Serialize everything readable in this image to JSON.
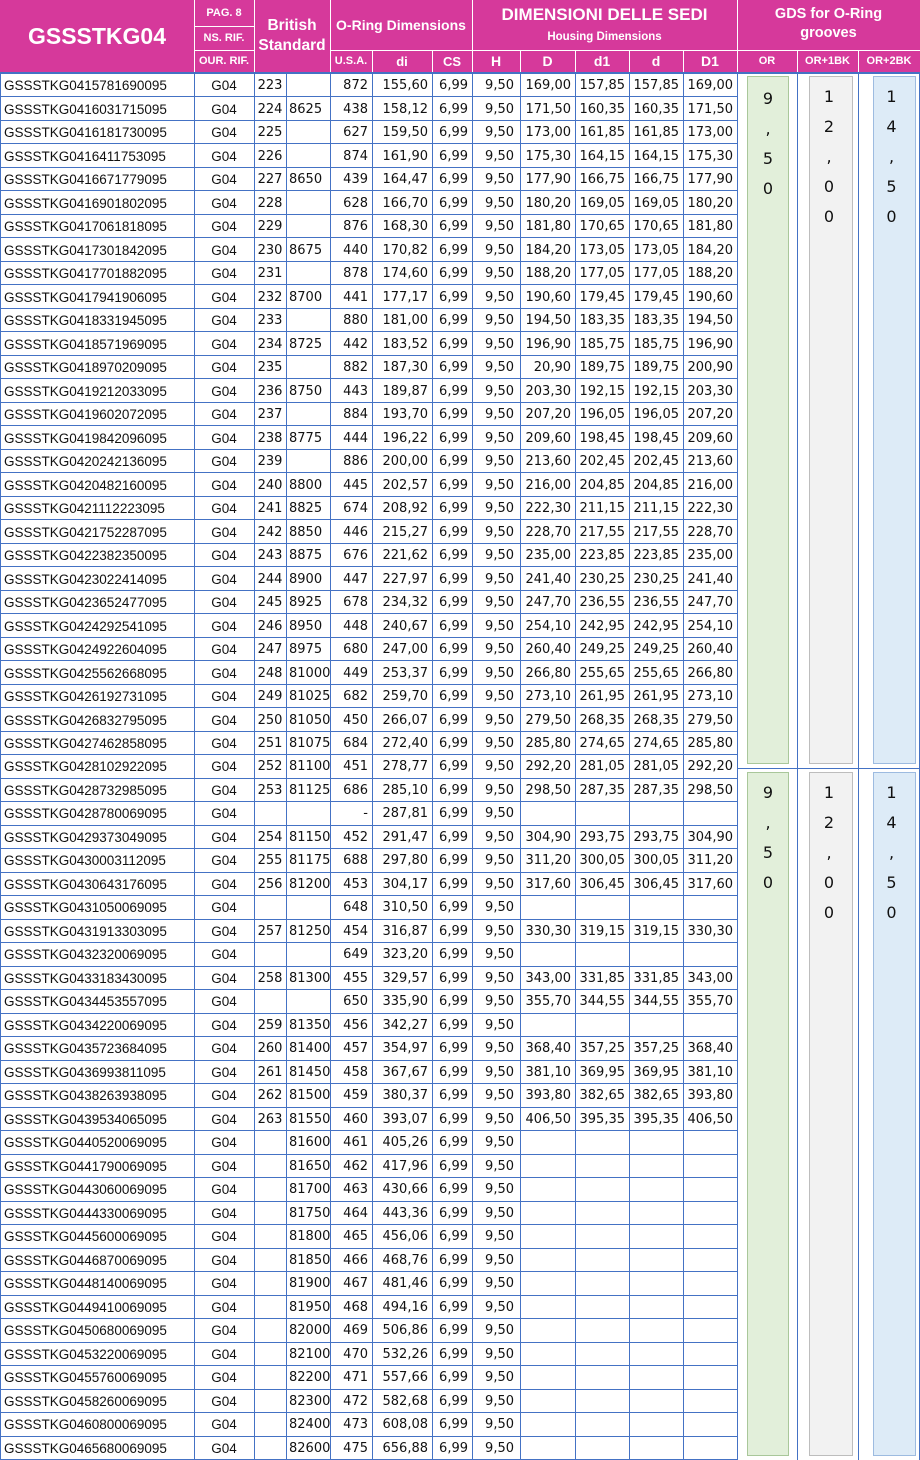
{
  "header": {
    "code_title": "GSSSTKG04",
    "pag": "PAG. 8",
    "ns_rif": "NS. RIF.",
    "our_rif": "OUR. RIF.",
    "british_standard": "British Standard",
    "oring_dimensions": "O-Ring Dimensions",
    "usa": "U.S.A.",
    "di": "di",
    "cs": "CS",
    "sedi_title": "DIMENSIONI DELLE SEDI",
    "housing": "Housing Dimensions",
    "h": "H",
    "d_upper": "D",
    "d1": "d1",
    "d_lower": "d",
    "D1": "D1",
    "gds_title": "GDS for O-Ring grooves",
    "or": "OR",
    "or1bk": "OR+1BK",
    "or2bk": "OR+2BK"
  },
  "gds_groups": [
    {
      "or": [
        "9",
        ",",
        "5",
        "0"
      ],
      "or1bk": [
        "1",
        "2",
        ",",
        "0",
        "0"
      ],
      "or2bk": [
        "1",
        "4",
        ",",
        "5",
        "0"
      ]
    },
    {
      "or": [
        "9",
        ",",
        "5",
        "0"
      ],
      "or1bk": [
        "1",
        "2",
        ",",
        "0",
        "0"
      ],
      "or2bk": [
        "1",
        "4",
        ",",
        "5",
        "0"
      ]
    }
  ],
  "colors": {
    "header_magenta": "#d6399b",
    "grid_blue": "#4472c4",
    "gds_green": "#e2efda",
    "gds_gray": "#f2f2f2",
    "gds_blue": "#ddebf7"
  },
  "rows": [
    [
      "GSSSTKG0415781690095",
      "G04",
      "223",
      "",
      "872",
      "155,60",
      "6,99",
      "9,50",
      "169,00",
      "157,85",
      "157,85",
      "169,00"
    ],
    [
      "GSSSTKG0416031715095",
      "G04",
      "224",
      "8625",
      "438",
      "158,12",
      "6,99",
      "9,50",
      "171,50",
      "160,35",
      "160,35",
      "171,50"
    ],
    [
      "GSSSTKG0416181730095",
      "G04",
      "225",
      "",
      "627",
      "159,50",
      "6,99",
      "9,50",
      "173,00",
      "161,85",
      "161,85",
      "173,00"
    ],
    [
      "GSSSTKG0416411753095",
      "G04",
      "226",
      "",
      "874",
      "161,90",
      "6,99",
      "9,50",
      "175,30",
      "164,15",
      "164,15",
      "175,30"
    ],
    [
      "GSSSTKG0416671779095",
      "G04",
      "227",
      "8650",
      "439",
      "164,47",
      "6,99",
      "9,50",
      "177,90",
      "166,75",
      "166,75",
      "177,90"
    ],
    [
      "GSSSTKG0416901802095",
      "G04",
      "228",
      "",
      "628",
      "166,70",
      "6,99",
      "9,50",
      "180,20",
      "169,05",
      "169,05",
      "180,20"
    ],
    [
      "GSSSTKG0417061818095",
      "G04",
      "229",
      "",
      "876",
      "168,30",
      "6,99",
      "9,50",
      "181,80",
      "170,65",
      "170,65",
      "181,80"
    ],
    [
      "GSSSTKG0417301842095",
      "G04",
      "230",
      "8675",
      "440",
      "170,82",
      "6,99",
      "9,50",
      "184,20",
      "173,05",
      "173,05",
      "184,20"
    ],
    [
      "GSSSTKG0417701882095",
      "G04",
      "231",
      "",
      "878",
      "174,60",
      "6,99",
      "9,50",
      "188,20",
      "177,05",
      "177,05",
      "188,20"
    ],
    [
      "GSSSTKG0417941906095",
      "G04",
      "232",
      "8700",
      "441",
      "177,17",
      "6,99",
      "9,50",
      "190,60",
      "179,45",
      "179,45",
      "190,60"
    ],
    [
      "GSSSTKG0418331945095",
      "G04",
      "233",
      "",
      "880",
      "181,00",
      "6,99",
      "9,50",
      "194,50",
      "183,35",
      "183,35",
      "194,50"
    ],
    [
      "GSSSTKG0418571969095",
      "G04",
      "234",
      "8725",
      "442",
      "183,52",
      "6,99",
      "9,50",
      "196,90",
      "185,75",
      "185,75",
      "196,90"
    ],
    [
      "GSSSTKG0418970209095",
      "G04",
      "235",
      "",
      "882",
      "187,30",
      "6,99",
      "9,50",
      "20,90",
      "189,75",
      "189,75",
      "200,90"
    ],
    [
      "GSSSTKG0419212033095",
      "G04",
      "236",
      "8750",
      "443",
      "189,87",
      "6,99",
      "9,50",
      "203,30",
      "192,15",
      "192,15",
      "203,30"
    ],
    [
      "GSSSTKG0419602072095",
      "G04",
      "237",
      "",
      "884",
      "193,70",
      "6,99",
      "9,50",
      "207,20",
      "196,05",
      "196,05",
      "207,20"
    ],
    [
      "GSSSTKG0419842096095",
      "G04",
      "238",
      "8775",
      "444",
      "196,22",
      "6,99",
      "9,50",
      "209,60",
      "198,45",
      "198,45",
      "209,60"
    ],
    [
      "GSSSTKG0420242136095",
      "G04",
      "239",
      "",
      "886",
      "200,00",
      "6,99",
      "9,50",
      "213,60",
      "202,45",
      "202,45",
      "213,60"
    ],
    [
      "GSSSTKG0420482160095",
      "G04",
      "240",
      "8800",
      "445",
      "202,57",
      "6,99",
      "9,50",
      "216,00",
      "204,85",
      "204,85",
      "216,00"
    ],
    [
      "GSSSTKG0421112223095",
      "G04",
      "241",
      "8825",
      "674",
      "208,92",
      "6,99",
      "9,50",
      "222,30",
      "211,15",
      "211,15",
      "222,30"
    ],
    [
      "GSSSTKG0421752287095",
      "G04",
      "242",
      "8850",
      "446",
      "215,27",
      "6,99",
      "9,50",
      "228,70",
      "217,55",
      "217,55",
      "228,70"
    ],
    [
      "GSSSTKG0422382350095",
      "G04",
      "243",
      "8875",
      "676",
      "221,62",
      "6,99",
      "9,50",
      "235,00",
      "223,85",
      "223,85",
      "235,00"
    ],
    [
      "GSSSTKG0423022414095",
      "G04",
      "244",
      "8900",
      "447",
      "227,97",
      "6,99",
      "9,50",
      "241,40",
      "230,25",
      "230,25",
      "241,40"
    ],
    [
      "GSSSTKG0423652477095",
      "G04",
      "245",
      "8925",
      "678",
      "234,32",
      "6,99",
      "9,50",
      "247,70",
      "236,55",
      "236,55",
      "247,70"
    ],
    [
      "GSSSTKG0424292541095",
      "G04",
      "246",
      "8950",
      "448",
      "240,67",
      "6,99",
      "9,50",
      "254,10",
      "242,95",
      "242,95",
      "254,10"
    ],
    [
      "GSSSTKG0424922604095",
      "G04",
      "247",
      "8975",
      "680",
      "247,00",
      "6,99",
      "9,50",
      "260,40",
      "249,25",
      "249,25",
      "260,40"
    ],
    [
      "GSSSTKG0425562668095",
      "G04",
      "248",
      "81000",
      "449",
      "253,37",
      "6,99",
      "9,50",
      "266,80",
      "255,65",
      "255,65",
      "266,80"
    ],
    [
      "GSSSTKG0426192731095",
      "G04",
      "249",
      "81025",
      "682",
      "259,70",
      "6,99",
      "9,50",
      "273,10",
      "261,95",
      "261,95",
      "273,10"
    ],
    [
      "GSSSTKG0426832795095",
      "G04",
      "250",
      "81050",
      "450",
      "266,07",
      "6,99",
      "9,50",
      "279,50",
      "268,35",
      "268,35",
      "279,50"
    ],
    [
      "GSSSTKG0427462858095",
      "G04",
      "251",
      "81075",
      "684",
      "272,40",
      "6,99",
      "9,50",
      "285,80",
      "274,65",
      "274,65",
      "285,80"
    ],
    [
      "GSSSTKG0428102922095",
      "G04",
      "252",
      "81100",
      "451",
      "278,77",
      "6,99",
      "9,50",
      "292,20",
      "281,05",
      "281,05",
      "292,20"
    ],
    [
      "GSSSTKG0428732985095",
      "G04",
      "253",
      "81125",
      "686",
      "285,10",
      "6,99",
      "9,50",
      "298,50",
      "287,35",
      "287,35",
      "298,50"
    ],
    [
      "GSSSTKG0428780069095",
      "G04",
      "",
      "",
      "-",
      "287,81",
      "6,99",
      "9,50",
      "",
      "",
      "",
      ""
    ],
    [
      "GSSSTKG0429373049095",
      "G04",
      "254",
      "81150",
      "452",
      "291,47",
      "6,99",
      "9,50",
      "304,90",
      "293,75",
      "293,75",
      "304,90"
    ],
    [
      "GSSSTKG0430003112095",
      "G04",
      "255",
      "81175",
      "688",
      "297,80",
      "6,99",
      "9,50",
      "311,20",
      "300,05",
      "300,05",
      "311,20"
    ],
    [
      "GSSSTKG0430643176095",
      "G04",
      "256",
      "81200",
      "453",
      "304,17",
      "6,99",
      "9,50",
      "317,60",
      "306,45",
      "306,45",
      "317,60"
    ],
    [
      "GSSSTKG0431050069095",
      "G04",
      "",
      "",
      "648",
      "310,50",
      "6,99",
      "9,50",
      "",
      "",
      "",
      ""
    ],
    [
      "GSSSTKG0431913303095",
      "G04",
      "257",
      "81250",
      "454",
      "316,87",
      "6,99",
      "9,50",
      "330,30",
      "319,15",
      "319,15",
      "330,30"
    ],
    [
      "GSSSTKG0432320069095",
      "G04",
      "",
      "",
      "649",
      "323,20",
      "6,99",
      "9,50",
      "",
      "",
      "",
      ""
    ],
    [
      "GSSSTKG0433183430095",
      "G04",
      "258",
      "81300",
      "455",
      "329,57",
      "6,99",
      "9,50",
      "343,00",
      "331,85",
      "331,85",
      "343,00"
    ],
    [
      "GSSSTKG0434453557095",
      "G04",
      "",
      "",
      "650",
      "335,90",
      "6,99",
      "9,50",
      "355,70",
      "344,55",
      "344,55",
      "355,70"
    ],
    [
      "GSSSTKG0434220069095",
      "G04",
      "259",
      "81350",
      "456",
      "342,27",
      "6,99",
      "9,50",
      "",
      "",
      "",
      ""
    ],
    [
      "GSSSTKG0435723684095",
      "G04",
      "260",
      "81400",
      "457",
      "354,97",
      "6,99",
      "9,50",
      "368,40",
      "357,25",
      "357,25",
      "368,40"
    ],
    [
      "GSSSTKG0436993811095",
      "G04",
      "261",
      "81450",
      "458",
      "367,67",
      "6,99",
      "9,50",
      "381,10",
      "369,95",
      "369,95",
      "381,10"
    ],
    [
      "GSSSTKG0438263938095",
      "G04",
      "262",
      "81500",
      "459",
      "380,37",
      "6,99",
      "9,50",
      "393,80",
      "382,65",
      "382,65",
      "393,80"
    ],
    [
      "GSSSTKG0439534065095",
      "G04",
      "263",
      "81550",
      "460",
      "393,07",
      "6,99",
      "9,50",
      "406,50",
      "395,35",
      "395,35",
      "406,50"
    ],
    [
      "GSSSTKG0440520069095",
      "G04",
      "",
      "81600",
      "461",
      "405,26",
      "6,99",
      "9,50",
      "",
      "",
      "",
      ""
    ],
    [
      "GSSSTKG0441790069095",
      "G04",
      "",
      "81650",
      "462",
      "417,96",
      "6,99",
      "9,50",
      "",
      "",
      "",
      ""
    ],
    [
      "GSSSTKG0443060069095",
      "G04",
      "",
      "81700",
      "463",
      "430,66",
      "6,99",
      "9,50",
      "",
      "",
      "",
      ""
    ],
    [
      "GSSSTKG0444330069095",
      "G04",
      "",
      "81750",
      "464",
      "443,36",
      "6,99",
      "9,50",
      "",
      "",
      "",
      ""
    ],
    [
      "GSSSTKG0445600069095",
      "G04",
      "",
      "81800",
      "465",
      "456,06",
      "6,99",
      "9,50",
      "",
      "",
      "",
      ""
    ],
    [
      "GSSSTKG0446870069095",
      "G04",
      "",
      "81850",
      "466",
      "468,76",
      "6,99",
      "9,50",
      "",
      "",
      "",
      ""
    ],
    [
      "GSSSTKG0448140069095",
      "G04",
      "",
      "81900",
      "467",
      "481,46",
      "6,99",
      "9,50",
      "",
      "",
      "",
      ""
    ],
    [
      "GSSSTKG0449410069095",
      "G04",
      "",
      "81950",
      "468",
      "494,16",
      "6,99",
      "9,50",
      "",
      "",
      "",
      ""
    ],
    [
      "GSSSTKG0450680069095",
      "G04",
      "",
      "82000",
      "469",
      "506,86",
      "6,99",
      "9,50",
      "",
      "",
      "",
      ""
    ],
    [
      "GSSSTKG0453220069095",
      "G04",
      "",
      "82100",
      "470",
      "532,26",
      "6,99",
      "9,50",
      "",
      "",
      "",
      ""
    ],
    [
      "GSSSTKG0455760069095",
      "G04",
      "",
      "82200",
      "471",
      "557,66",
      "6,99",
      "9,50",
      "",
      "",
      "",
      ""
    ],
    [
      "GSSSTKG0458260069095",
      "G04",
      "",
      "82300",
      "472",
      "582,68",
      "6,99",
      "9,50",
      "",
      "",
      "",
      ""
    ],
    [
      "GSSSTKG0460800069095",
      "G04",
      "",
      "82400",
      "473",
      "608,08",
      "6,99",
      "9,50",
      "",
      "",
      "",
      ""
    ],
    [
      "GSSSTKG0465680069095",
      "G04",
      "",
      "82600",
      "475",
      "656,88",
      "6,99",
      "9,50",
      "",
      "",
      "",
      ""
    ]
  ]
}
